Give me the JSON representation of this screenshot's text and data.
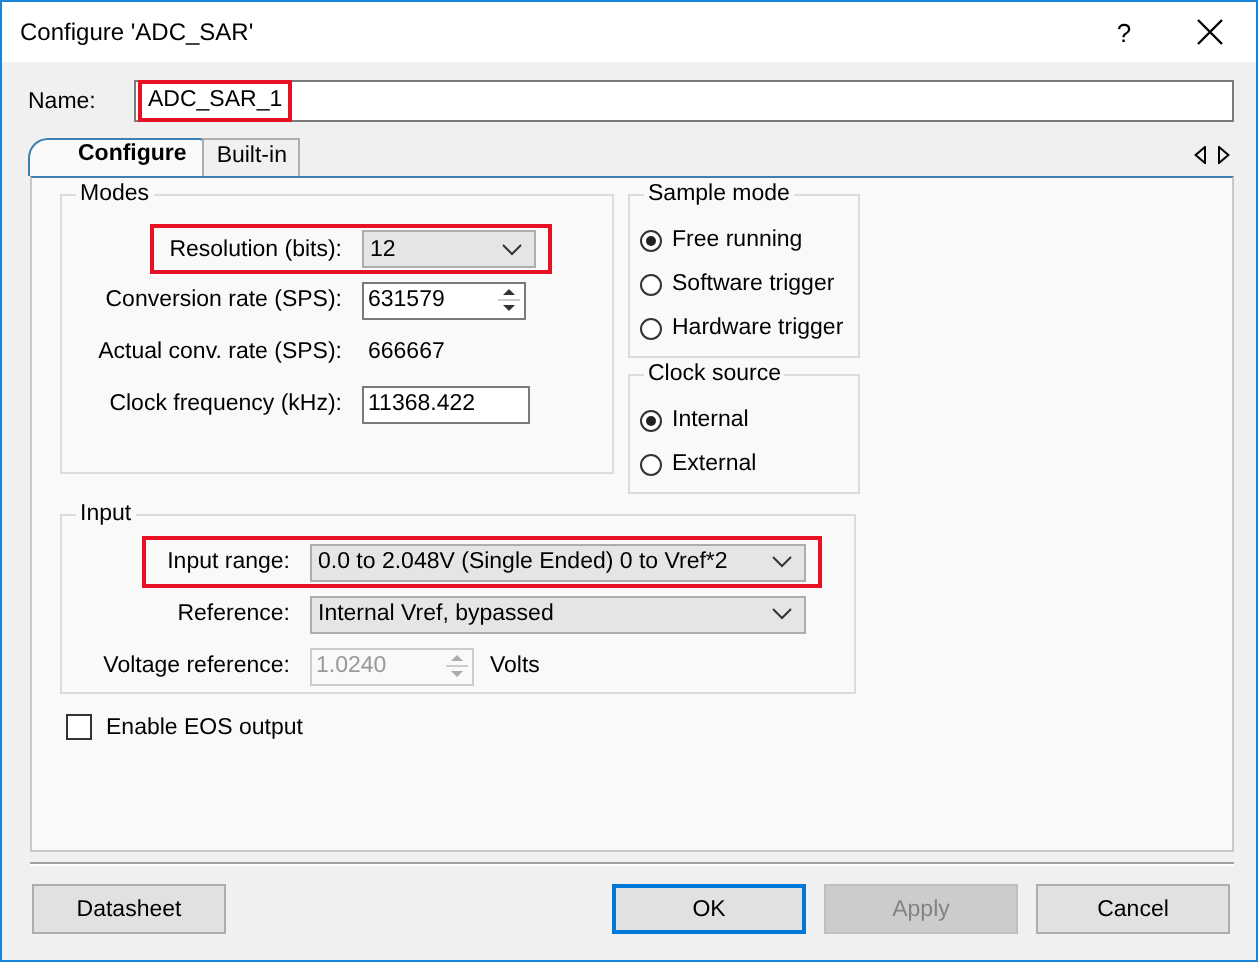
{
  "window": {
    "title": "Configure 'ADC_SAR'",
    "help": "?"
  },
  "name": {
    "label": "Name:",
    "value": "ADC_SAR_1",
    "highlighted": true
  },
  "tabs": [
    {
      "label": "Configure",
      "selected": true
    },
    {
      "label": "Built-in",
      "selected": false
    }
  ],
  "modes": {
    "title": "Modes",
    "rows": [
      {
        "kind": "dropdown",
        "label": "Resolution (bits):",
        "value": "12",
        "highlighted": true
      },
      {
        "kind": "spinner",
        "label": "Conversion rate (SPS):",
        "value": "631579",
        "disabled": false
      },
      {
        "kind": "readout",
        "label": "Actual conv. rate (SPS):",
        "value": "666667"
      },
      {
        "kind": "textbox",
        "label": "Clock frequency (kHz):",
        "value": "11368.422"
      }
    ]
  },
  "sample_mode": {
    "title": "Sample mode",
    "options": [
      {
        "label": "Free running",
        "selected": true
      },
      {
        "label": "Software trigger",
        "selected": false
      },
      {
        "label": "Hardware trigger",
        "selected": false
      }
    ]
  },
  "clock_source": {
    "title": "Clock source",
    "options": [
      {
        "label": "Internal",
        "selected": true
      },
      {
        "label": "External",
        "selected": false
      }
    ]
  },
  "input": {
    "title": "Input",
    "rows": [
      {
        "kind": "dropdown",
        "label": "Input range:",
        "value": "0.0 to 2.048V (Single Ended) 0 to Vref*2",
        "highlighted": true
      },
      {
        "kind": "dropdown",
        "label": "Reference:",
        "value": "Internal Vref, bypassed",
        "highlighted": false
      },
      {
        "kind": "spinner",
        "label": "Voltage reference:",
        "value": "1.0240",
        "disabled": true,
        "unit": "Volts"
      }
    ]
  },
  "checkbox": {
    "label": "Enable EOS output",
    "checked": false
  },
  "buttons": [
    {
      "label": "Datasheet",
      "kind": "aux",
      "focused": false,
      "disabled": false
    },
    {
      "label": "OK",
      "kind": "dialog",
      "focused": true,
      "disabled": false
    },
    {
      "label": "Apply",
      "kind": "dialog",
      "focused": false,
      "disabled": true
    },
    {
      "label": "Cancel",
      "kind": "dialog",
      "focused": false,
      "disabled": false
    }
  ]
}
